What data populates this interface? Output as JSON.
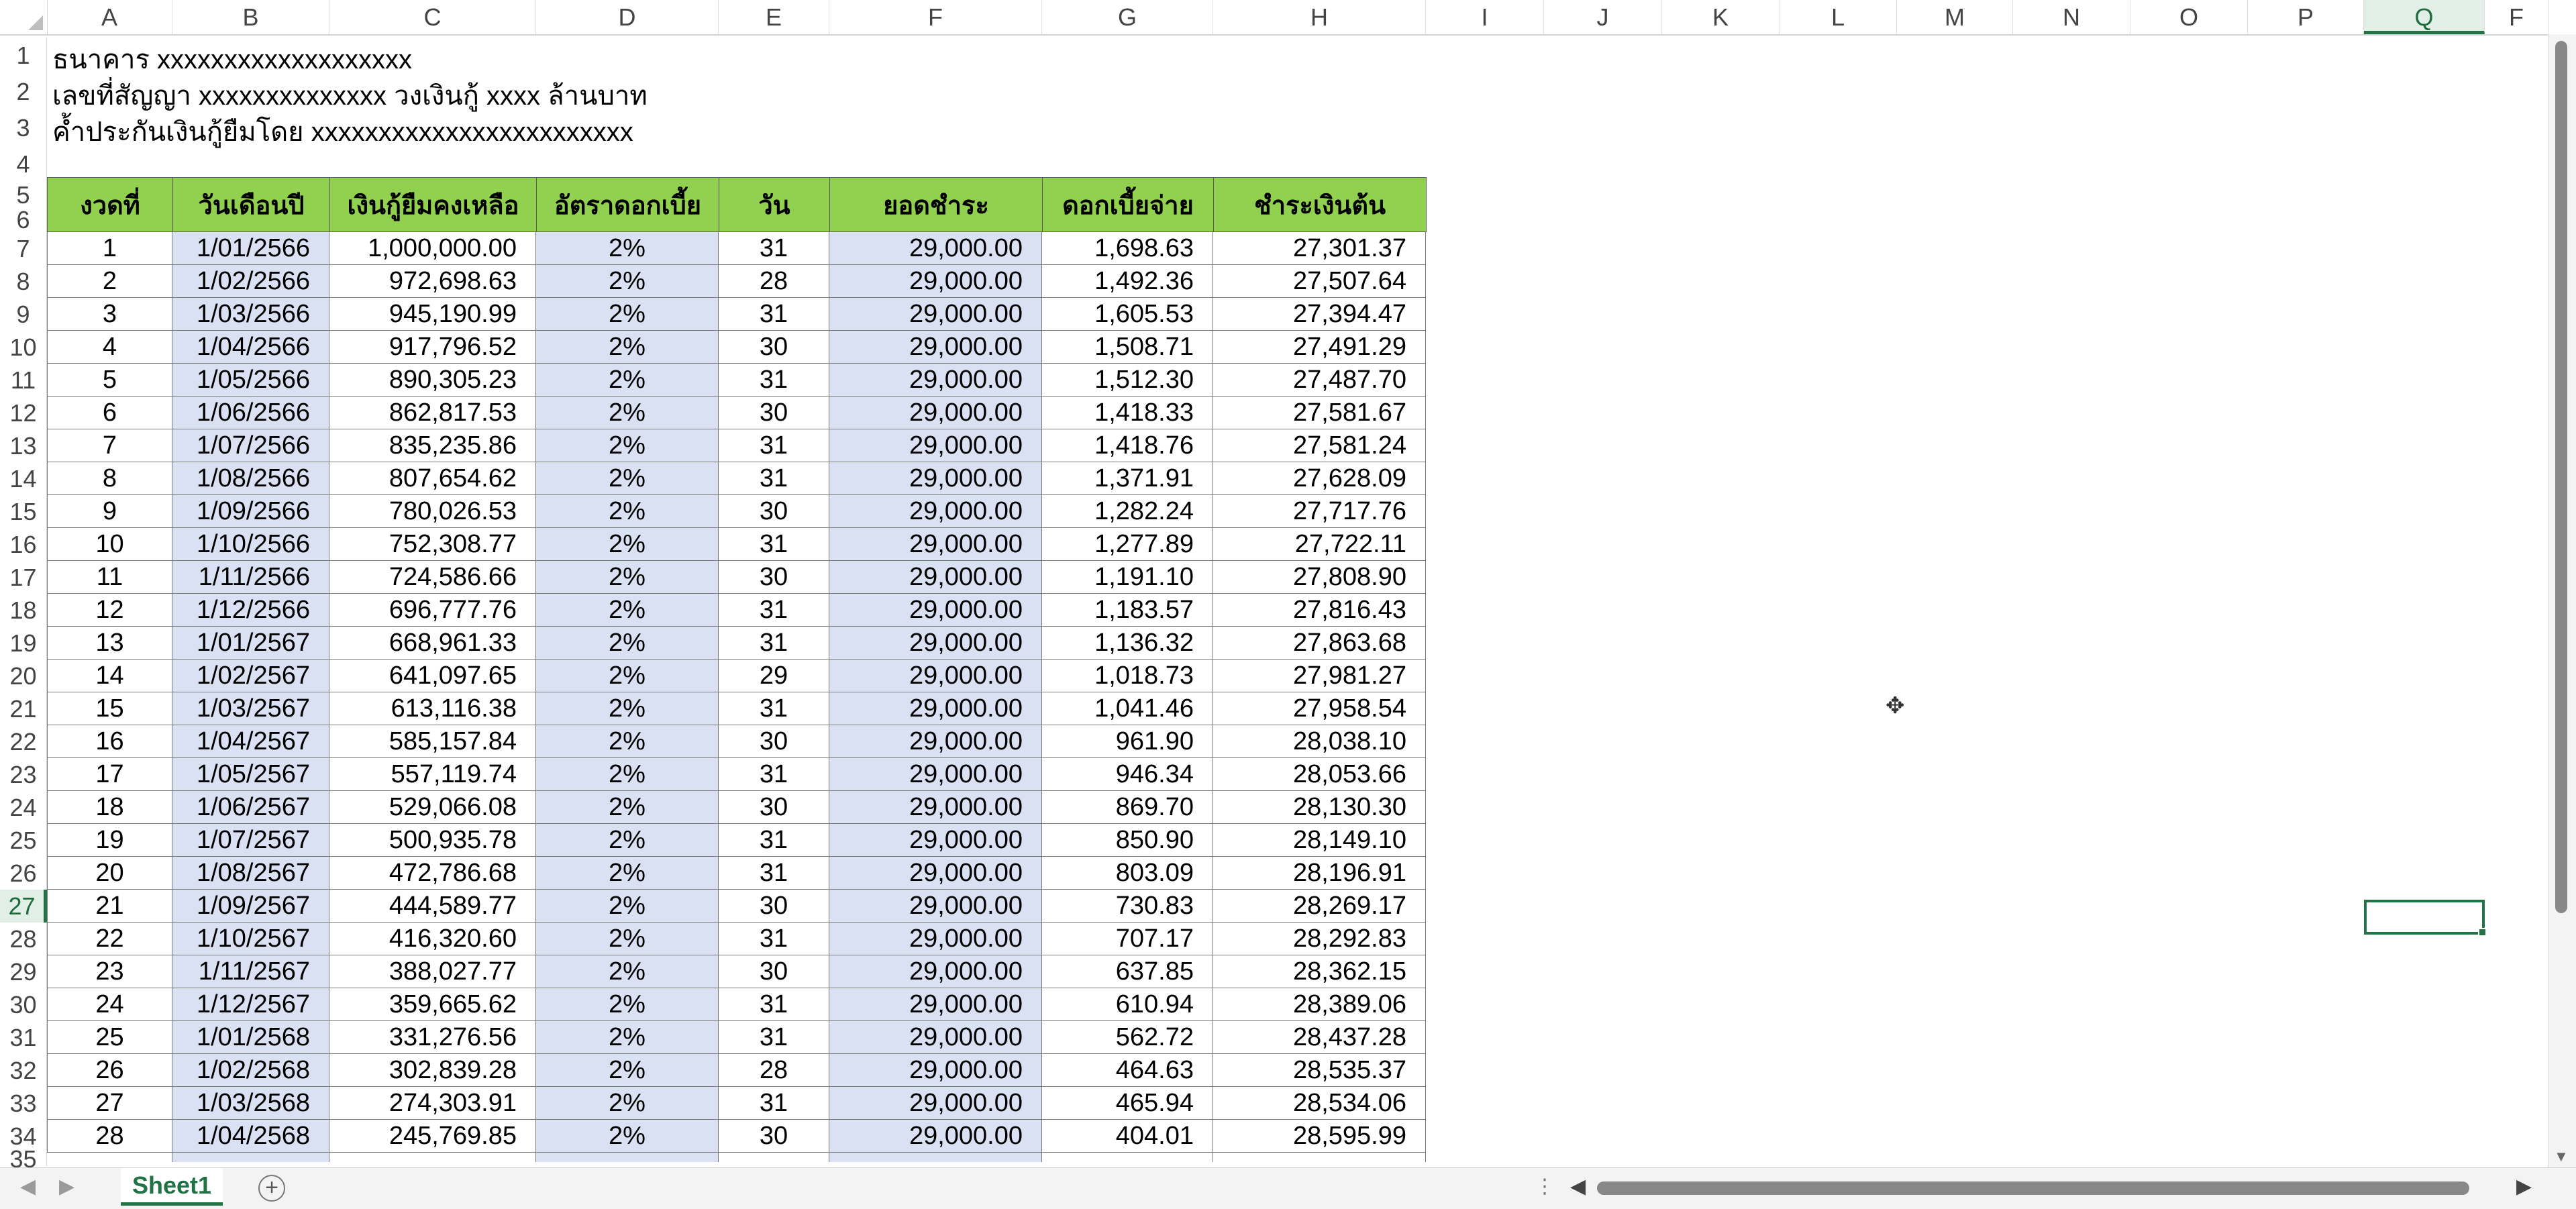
{
  "columns": [
    "A",
    "B",
    "C",
    "D",
    "E",
    "F",
    "G",
    "H",
    "I",
    "J",
    "K",
    "L",
    "M",
    "N",
    "O",
    "P",
    "Q",
    "F"
  ],
  "selected_column": "Q",
  "selected_row": "27",
  "header_lines": [
    "ธนาคาร xxxxxxxxxxxxxxxxxxx",
    "เลขที่สัญญา xxxxxxxxxxxxxx  วงเงินกู้ xxxx ล้านบาท",
    "ค้ำประกันเงินกู้ยืมโดย xxxxxxxxxxxxxxxxxxxxxxxx"
  ],
  "table_headers": [
    "งวดที่",
    "วันเดือนปี",
    "เงินกู้ยืมคงเหลือ",
    "อัตราดอกเบี้ย",
    "วัน",
    "ยอดชำระ",
    "ดอกเบี้ยจ่าย",
    "ชำระเงินต้น"
  ],
  "rows": [
    [
      "1",
      "1/01/2566",
      "1,000,000.00",
      "2%",
      "31",
      "29,000.00",
      "1,698.63",
      "27,301.37"
    ],
    [
      "2",
      "1/02/2566",
      "972,698.63",
      "2%",
      "28",
      "29,000.00",
      "1,492.36",
      "27,507.64"
    ],
    [
      "3",
      "1/03/2566",
      "945,190.99",
      "2%",
      "31",
      "29,000.00",
      "1,605.53",
      "27,394.47"
    ],
    [
      "4",
      "1/04/2566",
      "917,796.52",
      "2%",
      "30",
      "29,000.00",
      "1,508.71",
      "27,491.29"
    ],
    [
      "5",
      "1/05/2566",
      "890,305.23",
      "2%",
      "31",
      "29,000.00",
      "1,512.30",
      "27,487.70"
    ],
    [
      "6",
      "1/06/2566",
      "862,817.53",
      "2%",
      "30",
      "29,000.00",
      "1,418.33",
      "27,581.67"
    ],
    [
      "7",
      "1/07/2566",
      "835,235.86",
      "2%",
      "31",
      "29,000.00",
      "1,418.76",
      "27,581.24"
    ],
    [
      "8",
      "1/08/2566",
      "807,654.62",
      "2%",
      "31",
      "29,000.00",
      "1,371.91",
      "27,628.09"
    ],
    [
      "9",
      "1/09/2566",
      "780,026.53",
      "2%",
      "30",
      "29,000.00",
      "1,282.24",
      "27,717.76"
    ],
    [
      "10",
      "1/10/2566",
      "752,308.77",
      "2%",
      "31",
      "29,000.00",
      "1,277.89",
      "27,722.11"
    ],
    [
      "11",
      "1/11/2566",
      "724,586.66",
      "2%",
      "30",
      "29,000.00",
      "1,191.10",
      "27,808.90"
    ],
    [
      "12",
      "1/12/2566",
      "696,777.76",
      "2%",
      "31",
      "29,000.00",
      "1,183.57",
      "27,816.43"
    ],
    [
      "13",
      "1/01/2567",
      "668,961.33",
      "2%",
      "31",
      "29,000.00",
      "1,136.32",
      "27,863.68"
    ],
    [
      "14",
      "1/02/2567",
      "641,097.65",
      "2%",
      "29",
      "29,000.00",
      "1,018.73",
      "27,981.27"
    ],
    [
      "15",
      "1/03/2567",
      "613,116.38",
      "2%",
      "31",
      "29,000.00",
      "1,041.46",
      "27,958.54"
    ],
    [
      "16",
      "1/04/2567",
      "585,157.84",
      "2%",
      "30",
      "29,000.00",
      "961.90",
      "28,038.10"
    ],
    [
      "17",
      "1/05/2567",
      "557,119.74",
      "2%",
      "31",
      "29,000.00",
      "946.34",
      "28,053.66"
    ],
    [
      "18",
      "1/06/2567",
      "529,066.08",
      "2%",
      "30",
      "29,000.00",
      "869.70",
      "28,130.30"
    ],
    [
      "19",
      "1/07/2567",
      "500,935.78",
      "2%",
      "31",
      "29,000.00",
      "850.90",
      "28,149.10"
    ],
    [
      "20",
      "1/08/2567",
      "472,786.68",
      "2%",
      "31",
      "29,000.00",
      "803.09",
      "28,196.91"
    ],
    [
      "21",
      "1/09/2567",
      "444,589.77",
      "2%",
      "30",
      "29,000.00",
      "730.83",
      "28,269.17"
    ],
    [
      "22",
      "1/10/2567",
      "416,320.60",
      "2%",
      "31",
      "29,000.00",
      "707.17",
      "28,292.83"
    ],
    [
      "23",
      "1/11/2567",
      "388,027.77",
      "2%",
      "30",
      "29,000.00",
      "637.85",
      "28,362.15"
    ],
    [
      "24",
      "1/12/2567",
      "359,665.62",
      "2%",
      "31",
      "29,000.00",
      "610.94",
      "28,389.06"
    ],
    [
      "25",
      "1/01/2568",
      "331,276.56",
      "2%",
      "31",
      "29,000.00",
      "562.72",
      "28,437.28"
    ],
    [
      "26",
      "1/02/2568",
      "302,839.28",
      "2%",
      "28",
      "29,000.00",
      "464.63",
      "28,535.37"
    ],
    [
      "27",
      "1/03/2568",
      "274,303.91",
      "2%",
      "31",
      "29,000.00",
      "465.94",
      "28,534.06"
    ],
    [
      "28",
      "1/04/2568",
      "245,769.85",
      "2%",
      "30",
      "29,000.00",
      "404.01",
      "28,595.99"
    ]
  ],
  "sheet_tab": "Sheet1",
  "icons": {
    "add_sheet": "plus-circle-icon",
    "cursor": "cell-cross-cursor-icon",
    "scroll_left": "triangle-left-icon",
    "scroll_right": "triangle-right-icon",
    "scroll_up": "triangle-up-icon",
    "scroll_down": "triangle-down-icon"
  },
  "colors": {
    "header_fill": "#92d050",
    "band_fill": "#d9e1f2",
    "accent": "#217346"
  }
}
